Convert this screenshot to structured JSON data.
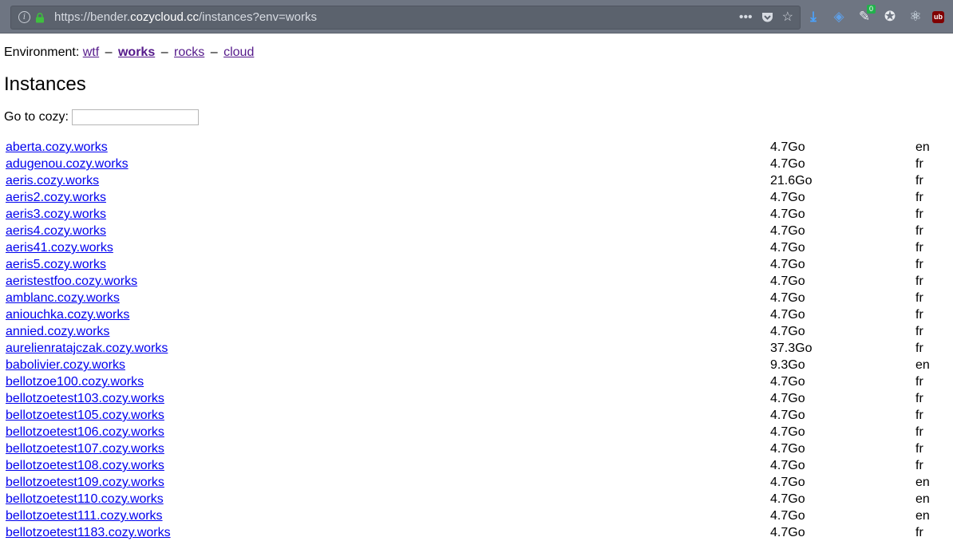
{
  "browser": {
    "url_prefix": "https://bender.",
    "url_host": "cozycloud.cc",
    "url_suffix": "/instances?env=works",
    "extension_badge": "0",
    "ublock_label": "ub"
  },
  "page": {
    "environment_label": "Environment:",
    "environments": [
      {
        "label": "wtf",
        "current": false
      },
      {
        "label": "works",
        "current": true
      },
      {
        "label": "rocks",
        "current": false
      },
      {
        "label": "cloud",
        "current": false
      }
    ],
    "separator": "–",
    "title": "Instances",
    "goto_label": "Go to cozy:",
    "goto_value": ""
  },
  "instances": [
    {
      "domain": "aberta.cozy.works",
      "size": "4.7Go",
      "locale": "en"
    },
    {
      "domain": "adugenou.cozy.works",
      "size": "4.7Go",
      "locale": "fr"
    },
    {
      "domain": "aeris.cozy.works",
      "size": "21.6Go",
      "locale": "fr"
    },
    {
      "domain": "aeris2.cozy.works",
      "size": "4.7Go",
      "locale": "fr"
    },
    {
      "domain": "aeris3.cozy.works",
      "size": "4.7Go",
      "locale": "fr"
    },
    {
      "domain": "aeris4.cozy.works",
      "size": "4.7Go",
      "locale": "fr"
    },
    {
      "domain": "aeris41.cozy.works",
      "size": "4.7Go",
      "locale": "fr"
    },
    {
      "domain": "aeris5.cozy.works",
      "size": "4.7Go",
      "locale": "fr"
    },
    {
      "domain": "aeristestfoo.cozy.works",
      "size": "4.7Go",
      "locale": "fr"
    },
    {
      "domain": "amblanc.cozy.works",
      "size": "4.7Go",
      "locale": "fr"
    },
    {
      "domain": "aniouchka.cozy.works",
      "size": "4.7Go",
      "locale": "fr"
    },
    {
      "domain": "annied.cozy.works",
      "size": "4.7Go",
      "locale": "fr"
    },
    {
      "domain": "aurelienratajczak.cozy.works",
      "size": "37.3Go",
      "locale": "fr"
    },
    {
      "domain": "babolivier.cozy.works",
      "size": "9.3Go",
      "locale": "en"
    },
    {
      "domain": "bellotzoe100.cozy.works",
      "size": "4.7Go",
      "locale": "fr"
    },
    {
      "domain": "bellotzoetest103.cozy.works",
      "size": "4.7Go",
      "locale": "fr"
    },
    {
      "domain": "bellotzoetest105.cozy.works",
      "size": "4.7Go",
      "locale": "fr"
    },
    {
      "domain": "bellotzoetest106.cozy.works",
      "size": "4.7Go",
      "locale": "fr"
    },
    {
      "domain": "bellotzoetest107.cozy.works",
      "size": "4.7Go",
      "locale": "fr"
    },
    {
      "domain": "bellotzoetest108.cozy.works",
      "size": "4.7Go",
      "locale": "fr"
    },
    {
      "domain": "bellotzoetest109.cozy.works",
      "size": "4.7Go",
      "locale": "en"
    },
    {
      "domain": "bellotzoetest110.cozy.works",
      "size": "4.7Go",
      "locale": "en"
    },
    {
      "domain": "bellotzoetest111.cozy.works",
      "size": "4.7Go",
      "locale": "en"
    },
    {
      "domain": "bellotzoetest1183.cozy.works",
      "size": "4.7Go",
      "locale": "fr"
    }
  ]
}
